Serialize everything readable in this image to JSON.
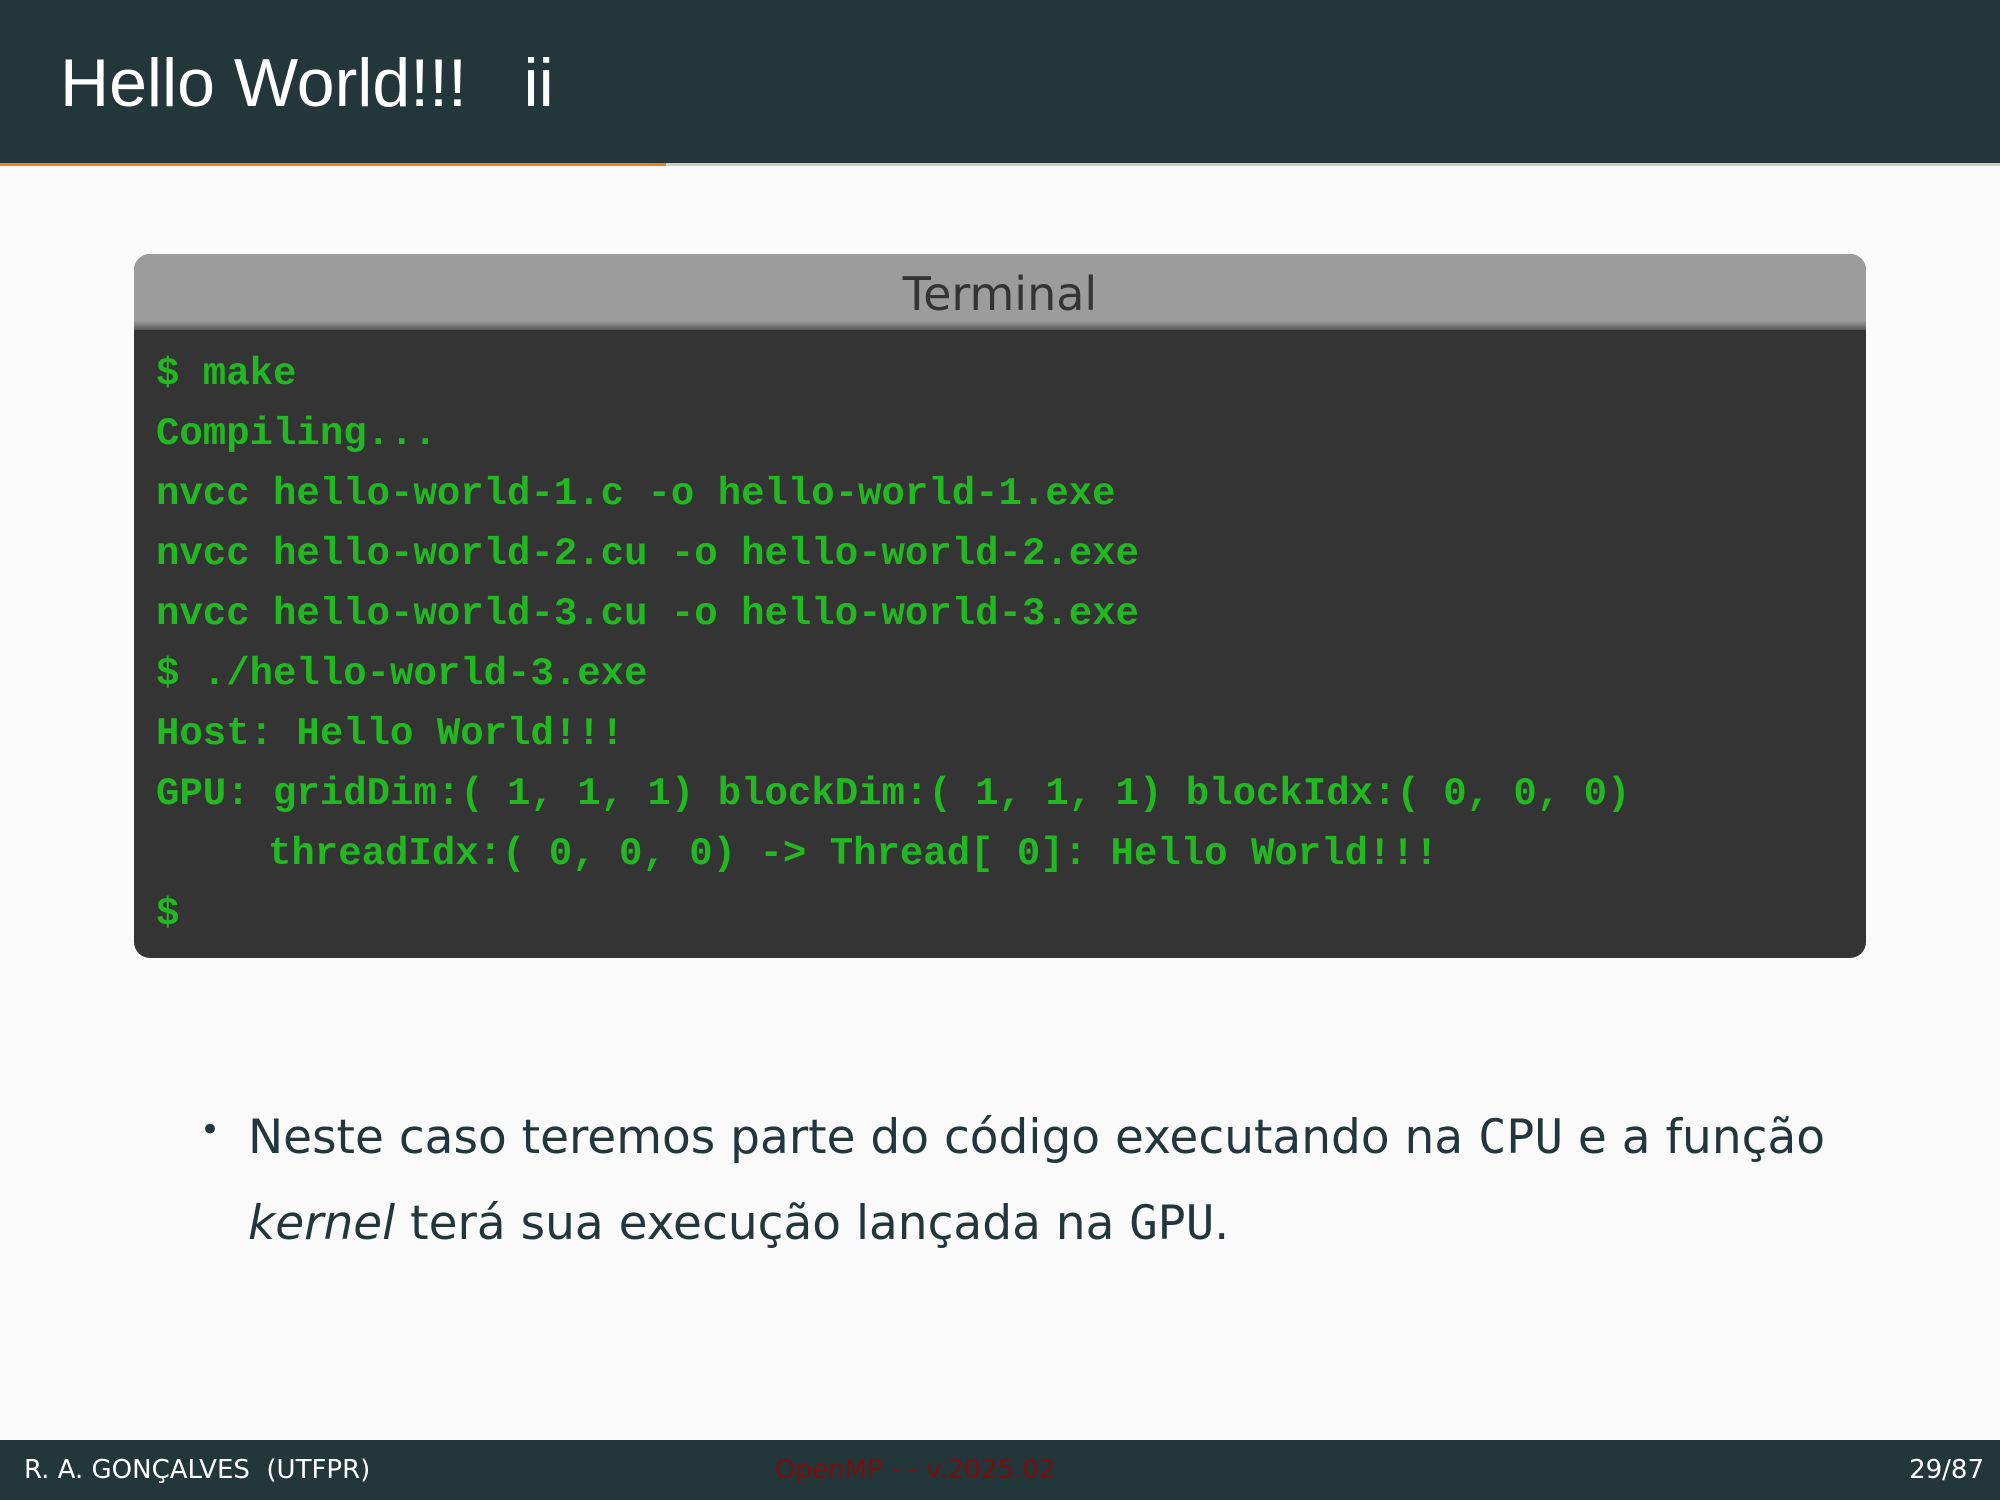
{
  "slide": {
    "title": "Hello World!!!   ii",
    "progress_fraction": 0.333
  },
  "terminal": {
    "title": "Terminal",
    "lines": [
      "$ make",
      "Compiling...",
      "nvcc hello-world-1.c -o hello-world-1.exe",
      "nvcc hello-world-2.cu -o hello-world-2.exe",
      "nvcc hello-world-3.cu -o hello-world-3.exe",
      "$ ./hello-world-3.exe",
      "Host: Hello World!!!",
      "GPU: gridDim:( 1, 1, 1) blockDim:( 1, 1, 1) blockIdx:( 0, 0, 0)",
      "threadIdx:( 0, 0, 0) -> Thread[ 0]: Hello World!!!",
      "$"
    ]
  },
  "bullet": {
    "marker": "•",
    "part1": "Neste caso teremos parte do código executando na ",
    "cpu": "CPU",
    "part2": " e a função ",
    "kernel": "kernel",
    "part3": " terá sua execução lançada na ",
    "gpu": "GPU",
    "part4": "."
  },
  "footer": {
    "author": "R. A. GONÇALVES  (UTFPR)",
    "center": "OpenMP - - v.2025.02",
    "page": "29/87"
  },
  "colors": {
    "header_bg": "#23373b",
    "accent": "#eb811b",
    "terminal_text": "#22b822",
    "terminal_bg": "#343434"
  }
}
